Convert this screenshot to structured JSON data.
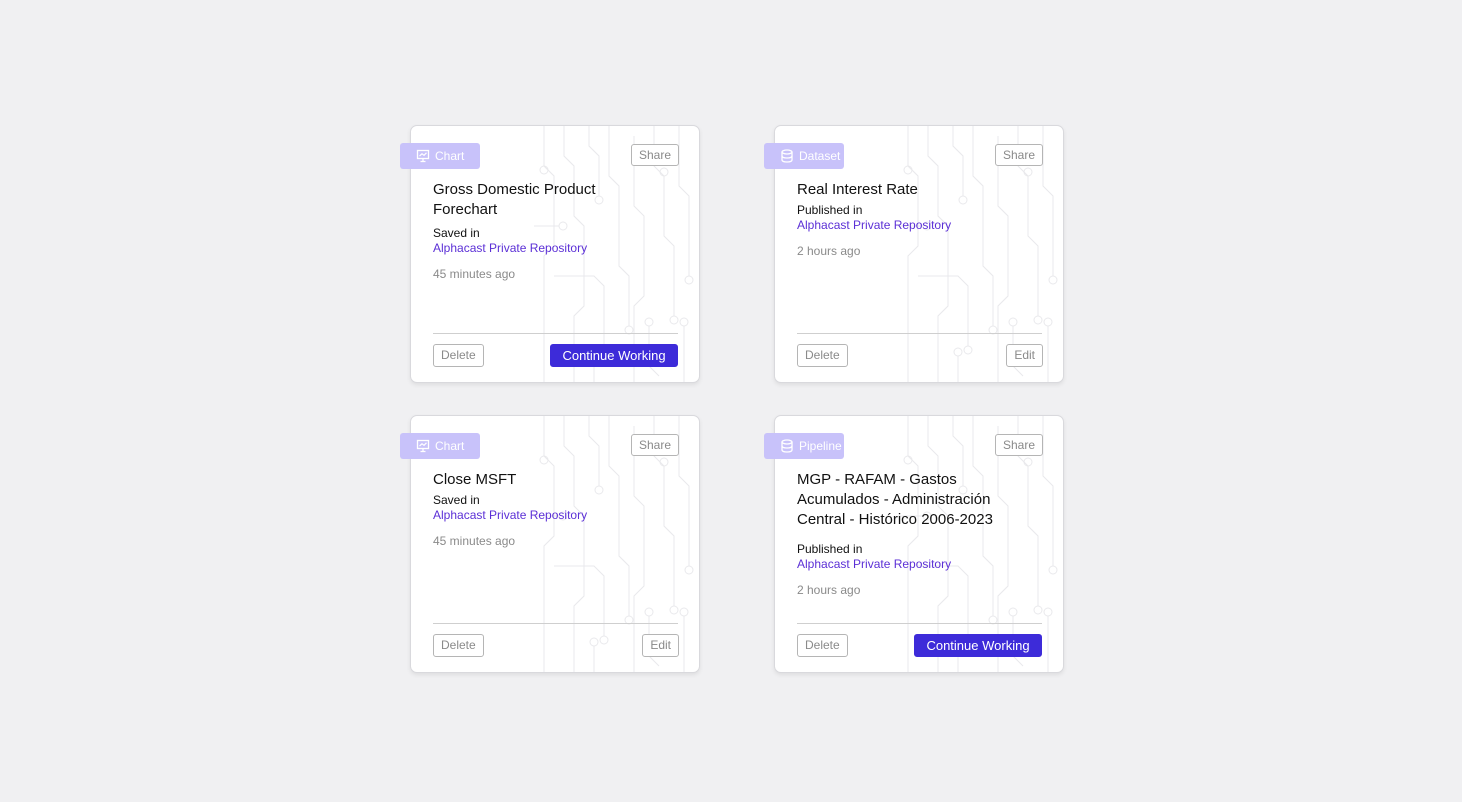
{
  "cards": [
    {
      "type_label": "Chart",
      "type_icon": "chart-icon",
      "share_label": "Share",
      "title": "Gross Domestic Product Forechart",
      "status_label": "Saved in",
      "repository": "Alphacast Private Repository",
      "time_ago": "45 minutes ago",
      "delete_label": "Delete",
      "action_label": "Continue Working"
    },
    {
      "type_label": "Dataset",
      "type_icon": "database-icon",
      "share_label": "Share",
      "title": "Real Interest Rate",
      "status_label": "Published in",
      "repository": "Alphacast Private Repository",
      "time_ago": "2 hours ago",
      "delete_label": "Delete",
      "action_label": "Edit"
    },
    {
      "type_label": "Chart",
      "type_icon": "chart-icon",
      "share_label": "Share",
      "title": "Close MSFT",
      "status_label": "Saved in",
      "repository": "Alphacast Private Repository",
      "time_ago": "45 minutes ago",
      "delete_label": "Delete",
      "action_label": "Edit"
    },
    {
      "type_label": "Pipeline",
      "type_icon": "database-icon",
      "share_label": "Share",
      "title": "MGP - RAFAM - Gastos Acumulados - Administración Central - Histórico 2006-2023",
      "status_label": "Published in",
      "repository": "Alphacast Private Repository",
      "time_ago": "2 hours ago",
      "delete_label": "Delete",
      "action_label": "Continue Working"
    }
  ],
  "colors": {
    "background": "#f0f0f2",
    "tag": "#c8c2fa",
    "primary": "#3d2bd9",
    "link": "#5b2fd6"
  }
}
